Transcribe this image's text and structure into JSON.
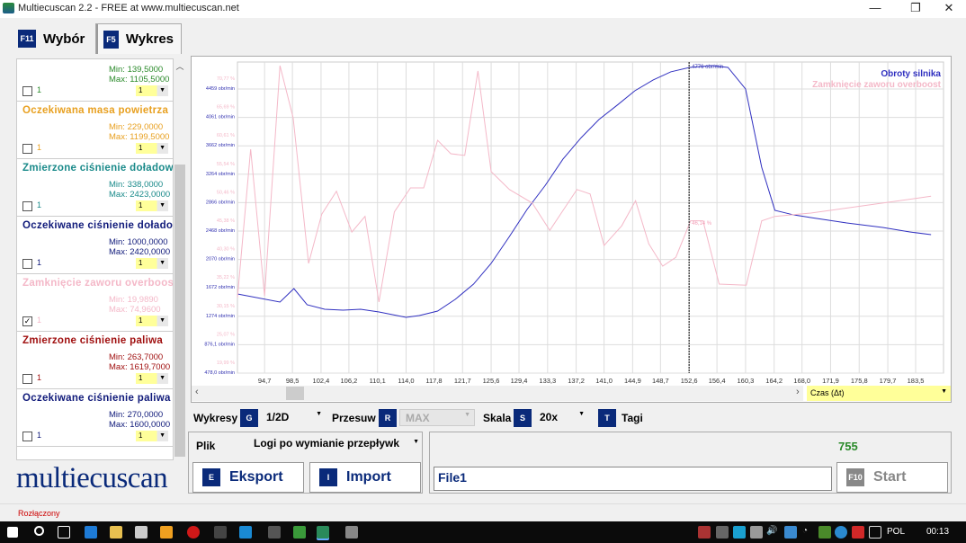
{
  "window": {
    "title": "Multiecuscan 2.2 - FREE at www.multiecuscan.net",
    "minimize": "—",
    "restore": "❐",
    "close": "✕"
  },
  "tabs": [
    {
      "key": "F11",
      "label": "Wybór"
    },
    {
      "key": "F5",
      "label": "Wykres"
    }
  ],
  "params": [
    {
      "name": "",
      "min": "Min: 139,5000",
      "max": "Max: 1105,5000",
      "checked": false,
      "num": "1",
      "sel": "1",
      "color": "#2a8a2a"
    },
    {
      "name": "Oczekiwana masa powietrza",
      "min": "Min: 229,0000",
      "max": "Max: 1199,5000",
      "checked": false,
      "num": "1",
      "sel": "1",
      "color": "#e8a020"
    },
    {
      "name": "Zmierzone ciśnienie doładowa",
      "min": "Min: 338,0000",
      "max": "Max: 2423,0000",
      "checked": false,
      "num": "1",
      "sel": "1",
      "color": "#1a8a8a"
    },
    {
      "name": "Oczekiwane ciśnienie doładow",
      "min": "Min: 1000,0000",
      "max": "Max: 2420,0000",
      "checked": false,
      "num": "1",
      "sel": "1",
      "color": "#101a7a"
    },
    {
      "name": "Zamknięcie zaworu overboost",
      "min": "Min: 19,9890",
      "max": "Max: 74,9600",
      "checked": true,
      "num": "1",
      "sel": "1",
      "color": "#f4b8c8"
    },
    {
      "name": "Zmierzone ciśnienie paliwa",
      "min": "Min: 263,7000",
      "max": "Max: 1619,7000",
      "checked": false,
      "num": "1",
      "sel": "1",
      "color": "#a01010"
    },
    {
      "name": "Oczekiwane ciśnienie paliwa",
      "min": "Min: 270,0000",
      "max": "Max: 1600,0000",
      "checked": false,
      "num": "1",
      "sel": "1",
      "color": "#101a7a"
    }
  ],
  "chart_data": {
    "type": "line",
    "xlabel": "Czas (Δt)",
    "xlim": [
      91.0,
      187.3
    ],
    "x_ticks": [
      "94,7",
      "98,5",
      "102,4",
      "106,2",
      "110,1",
      "114,0",
      "117,8",
      "121,7",
      "125,6",
      "129,4",
      "133,3",
      "137,2",
      "141,0",
      "144,9",
      "148,7",
      "152,6",
      "156,4",
      "160,3",
      "164,2",
      "168,0",
      "171,9",
      "175,8",
      "179,7",
      "183,5"
    ],
    "y_ticks_rpm": [
      "478,0 obr/min",
      "876,1 obr/min",
      "1274 obr/min",
      "1672 obr/min",
      "2070 obr/min",
      "2468 obr/min",
      "2866 obr/min",
      "3264 obr/min",
      "3662 obr/min",
      "4061 obr/min",
      "4459 obr/min"
    ],
    "y_ticks_pct": [
      "19,99 %",
      "25,07 %",
      "30,15 %",
      "35,22 %",
      "40,30 %",
      "45,38 %",
      "50,46 %",
      "55,54 %",
      "60,61 %",
      "65,69 %",
      "70,77 %"
    ],
    "ylim_rpm": [
      478.0,
      4837
    ],
    "ylim_pct": [
      19.99,
      74.8
    ],
    "grid": true,
    "legend_position": "top-right",
    "series": [
      {
        "name": "Obroty silnika",
        "color": "#3030c0",
        "axis": "rpm",
        "x": [
          91.0,
          96.8,
          98.7,
          100.5,
          102.9,
          105.4,
          107.8,
          110.3,
          114.0,
          115.8,
          118.3,
          120.7,
          123.2,
          125.6,
          128.1,
          130.5,
          133.0,
          135.4,
          137.9,
          140.3,
          142.8,
          145.2,
          147.7,
          150.1,
          152.7,
          155.7,
          157.9,
          160.3,
          162.5,
          164.3,
          166.8,
          169.2,
          174.1,
          179.0,
          182.7,
          185.6
        ],
        "y": [
          1587,
          1473,
          1662,
          1436,
          1373,
          1360,
          1373,
          1335,
          1259,
          1284,
          1347,
          1511,
          1725,
          2015,
          2393,
          2771,
          3111,
          3477,
          3779,
          4031,
          4233,
          4434,
          4586,
          4699,
          4762,
          4787,
          4762,
          4460,
          3363,
          2759,
          2696,
          2658,
          2582,
          2519,
          2456,
          2418
        ]
      },
      {
        "name": "Zamknięcie zaworu overboost",
        "color": "#f4b8c8",
        "axis": "pct",
        "x": [
          91.0,
          92.8,
          94.7,
          96.8,
          98.6,
          100.7,
          102.5,
          104.5,
          106.6,
          108.4,
          110.3,
          112.4,
          114.6,
          116.4,
          118.3,
          120.1,
          122.0,
          123.8,
          125.6,
          128.1,
          131.2,
          133.6,
          137.3,
          139.1,
          141.0,
          143.4,
          145.3,
          147.1,
          149.0,
          150.8,
          152.8,
          154.5,
          156.7,
          160.4,
          162.5,
          164.3,
          169.2,
          185.6
        ],
        "y": [
          33.5,
          60.0,
          33.8,
          74.95,
          65.6,
          39.6,
          48.4,
          52.5,
          45.2,
          48.0,
          32.7,
          48.8,
          53.1,
          53.1,
          61.6,
          59.2,
          58.9,
          74.0,
          56.0,
          52.8,
          50.4,
          45.5,
          52.8,
          52.0,
          42.8,
          46.3,
          50.8,
          43.1,
          39.1,
          40.7,
          47.2,
          47.2,
          35.9,
          35.7,
          47.2,
          48.0,
          48.6,
          51.6
        ]
      }
    ],
    "cursor": {
      "x": 152.6,
      "label_rpm": "4776 obr/min",
      "label_pct": "46,14 %"
    }
  },
  "controls": {
    "wykresy_label": "Wykresy",
    "wykresy_key": "G",
    "wykresy_value": "1/2D",
    "przesuw_label": "Przesuw",
    "przesuw_key": "R",
    "przesuw_value": "MAX",
    "skala_label": "Skala",
    "skala_key": "S",
    "skala_value": "20x",
    "tagi_key": "T",
    "tagi_label": "Tagi"
  },
  "file": {
    "label": "Plik",
    "value": "Logi po wymianie przepływk",
    "export_key": "E",
    "export_label": "Eksport",
    "import_key": "I",
    "import_label": "Import"
  },
  "run": {
    "counter": "755",
    "file_value": "File1",
    "start_key": "F10",
    "start_label": "Start"
  },
  "logo": "multiecuscan",
  "status": "Rozłączony",
  "taskbar": {
    "lang": "POL",
    "time": "00:13"
  }
}
